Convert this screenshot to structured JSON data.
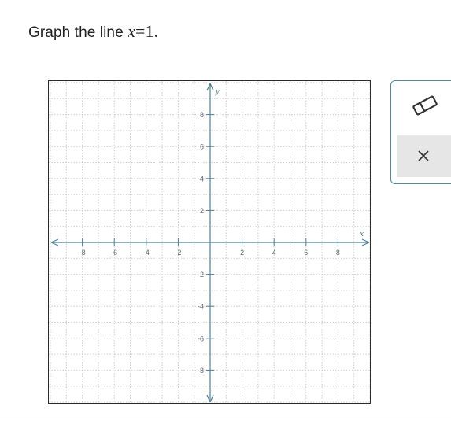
{
  "question": {
    "prefix": "Graph the line ",
    "variable": "x",
    "operator": "=",
    "value": "1."
  },
  "graph": {
    "x_axis_label": "x",
    "y_axis_label": "y",
    "x_range": [
      -10,
      10
    ],
    "y_range": [
      -10,
      10
    ],
    "x_tick_labels": [
      "-8",
      "-6",
      "-4",
      "-2",
      "2",
      "4",
      "6",
      "8"
    ],
    "y_tick_labels": [
      "8",
      "6",
      "4",
      "2",
      "-2",
      "-4",
      "-6",
      "-8"
    ],
    "grid": true,
    "axis_color": "#4f7f94",
    "grid_color": "#d8d8d8"
  },
  "tools": {
    "eraser_icon": "eraser-icon",
    "close_icon": "close-icon",
    "panel_border_color": "#4e8aa6"
  }
}
